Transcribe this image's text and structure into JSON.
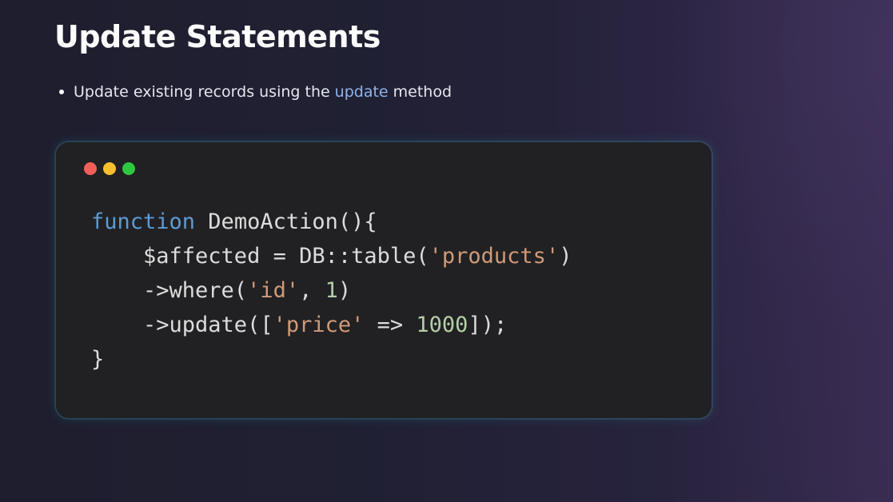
{
  "slide": {
    "title": "Update Statements",
    "bullet": {
      "before": "Update existing records using the",
      "keyword": "update",
      "after": "method"
    }
  },
  "code_window": {
    "traffic_lights": [
      "#f25f57",
      "#f7be2e",
      "#2ec840"
    ],
    "lines": [
      {
        "tokens": [
          {
            "t": "kw",
            "v": "function"
          },
          {
            "t": "plain",
            "v": " DemoAction(){"
          }
        ]
      },
      {
        "tokens": [
          {
            "t": "plain",
            "v": "    $affected = DB::table("
          },
          {
            "t": "str",
            "v": "'products'"
          },
          {
            "t": "plain",
            "v": ")"
          }
        ]
      },
      {
        "tokens": [
          {
            "t": "plain",
            "v": "    ->where("
          },
          {
            "t": "str",
            "v": "'id'"
          },
          {
            "t": "plain",
            "v": ", "
          },
          {
            "t": "num",
            "v": "1"
          },
          {
            "t": "plain",
            "v": ")"
          }
        ]
      },
      {
        "tokens": [
          {
            "t": "plain",
            "v": "    ->update(["
          },
          {
            "t": "str",
            "v": "'price'"
          },
          {
            "t": "plain",
            "v": " => "
          },
          {
            "t": "num",
            "v": "1000"
          },
          {
            "t": "plain",
            "v": "]);"
          }
        ]
      },
      {
        "tokens": [
          {
            "t": "plain",
            "v": "}"
          }
        ]
      }
    ]
  },
  "colors": {
    "keyword": "#5d9bd6",
    "string": "#d09a78",
    "number": "#b4cea8",
    "highlight": "#8fb3e8"
  }
}
